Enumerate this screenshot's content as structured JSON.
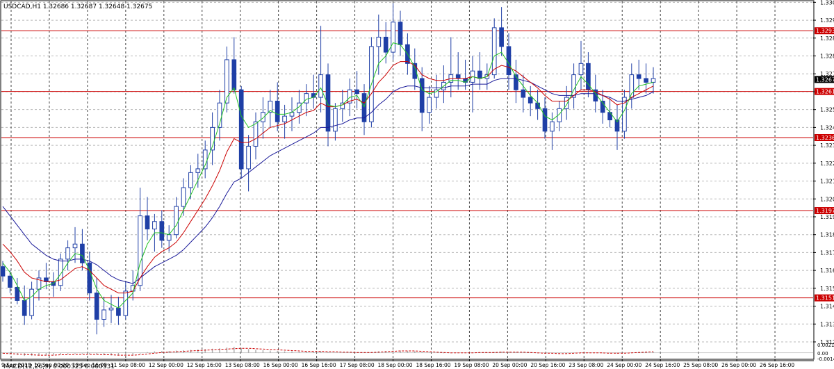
{
  "header": {
    "text": "USDCAD,H1  1.32686 1.32687 1.32648 1.32675"
  },
  "macd_header": {
    "text": "MACD(12,26,9) 0.000325 0.000331"
  },
  "colors": {
    "candle": "#1f3fa6",
    "ma_fast": "#22c222",
    "ma_mid": "#cc0000",
    "ma_slow": "#1a1a99",
    "hline": "#cc0000",
    "current_price_bg": "#000000",
    "level_bg": "#cc0000",
    "macd_hist": "#b0b0b0",
    "macd_signal": "#cc0000",
    "grid": "#b8b8b8"
  },
  "chart_data": [
    {
      "type": "candlestick",
      "symbol": "USDCAD",
      "timeframe": "H1",
      "ylim": [
        1.3128,
        1.3309
      ],
      "price_ticks": [
        "1.33085",
        "1.32990",
        "1.32895",
        "1.32800",
        "1.32705",
        "1.32610",
        "1.32515",
        "1.32420",
        "1.32325",
        "1.32230",
        "1.32135",
        "1.32040",
        "1.31945",
        "1.31850",
        "1.31755",
        "1.31660",
        "1.31565",
        "1.31470",
        "1.31375",
        "1.31280"
      ],
      "time_labels": [
        "9 Sep 2019",
        "10 Sep 00:00",
        "10 Sep 16:00",
        "11 Sep 08:00",
        "12 Sep 00:00",
        "12 Sep 16:00",
        "13 Sep 08:00",
        "16 Sep 00:00",
        "16 Sep 16:00",
        "17 Sep 08:00",
        "18 Sep 00:00",
        "18 Sep 16:00",
        "19 Sep 08:00",
        "20 Sep 00:00",
        "20 Sep 16:00",
        "23 Sep 08:00",
        "24 Sep 00:00",
        "24 Sep 16:00",
        "25 Sep 08:00",
        "26 Sep 00:00",
        "26 Sep 16:00"
      ],
      "horizontal_levels": [
        "1.32934",
        "1.32366",
        "1.31978",
        "1.31514"
      ],
      "price_level_labels": [
        {
          "label": "1.32934",
          "value": 1.32934,
          "kind": "level"
        },
        {
          "label": "1.32675",
          "value": 1.32675,
          "kind": "current"
        },
        {
          "label": "1.32611",
          "value": 1.32611,
          "kind": "level"
        },
        {
          "label": "1.32366",
          "value": 1.32366,
          "kind": "level"
        },
        {
          "label": "1.31978",
          "value": 1.31978,
          "kind": "level"
        },
        {
          "label": "1.31514",
          "value": 1.31514,
          "kind": "level"
        }
      ],
      "candles": [
        [
          1.3168,
          1.3171,
          1.316,
          1.3163
        ],
        [
          1.3163,
          1.3166,
          1.3154,
          1.3157
        ],
        [
          1.3157,
          1.3162,
          1.3148,
          1.315
        ],
        [
          1.315,
          1.3158,
          1.3137,
          1.3142
        ],
        [
          1.3142,
          1.316,
          1.314,
          1.3156
        ],
        [
          1.3156,
          1.3166,
          1.315,
          1.3162
        ],
        [
          1.3162,
          1.317,
          1.3156,
          1.316
        ],
        [
          1.316,
          1.3165,
          1.3152,
          1.3158
        ],
        [
          1.3158,
          1.3175,
          1.3155,
          1.3172
        ],
        [
          1.3172,
          1.3182,
          1.3166,
          1.3178
        ],
        [
          1.3178,
          1.3189,
          1.317,
          1.318
        ],
        [
          1.318,
          1.3188,
          1.3166,
          1.317
        ],
        [
          1.317,
          1.3176,
          1.315,
          1.3154
        ],
        [
          1.3154,
          1.3162,
          1.3132,
          1.314
        ],
        [
          1.314,
          1.3152,
          1.3136,
          1.3145
        ],
        [
          1.3145,
          1.3153,
          1.3138,
          1.3146
        ],
        [
          1.3146,
          1.3152,
          1.3137,
          1.3142
        ],
        [
          1.3142,
          1.316,
          1.314,
          1.3155
        ],
        [
          1.3155,
          1.3166,
          1.315,
          1.3158
        ],
        [
          1.3158,
          1.321,
          1.3155,
          1.3195
        ],
        [
          1.3195,
          1.3205,
          1.3182,
          1.3188
        ],
        [
          1.3188,
          1.3196,
          1.3176,
          1.3192
        ],
        [
          1.3192,
          1.3198,
          1.3178,
          1.3182
        ],
        [
          1.3182,
          1.319,
          1.3176,
          1.3185
        ],
        [
          1.3185,
          1.3205,
          1.3183,
          1.32
        ],
        [
          1.32,
          1.3215,
          1.3195,
          1.321
        ],
        [
          1.321,
          1.3222,
          1.3204,
          1.3218
        ],
        [
          1.3218,
          1.3228,
          1.321,
          1.322
        ],
        [
          1.322,
          1.3235,
          1.3215,
          1.323
        ],
        [
          1.323,
          1.325,
          1.3222,
          1.3242
        ],
        [
          1.3242,
          1.3262,
          1.3235,
          1.3255
        ],
        [
          1.3255,
          1.3285,
          1.325,
          1.3278
        ],
        [
          1.3278,
          1.329,
          1.326,
          1.3262
        ],
        [
          1.3262,
          1.3264,
          1.3215,
          1.322
        ],
        [
          1.322,
          1.3238,
          1.3208,
          1.3232
        ],
        [
          1.3232,
          1.325,
          1.3225,
          1.3245
        ],
        [
          1.3245,
          1.3258,
          1.3236,
          1.325
        ],
        [
          1.325,
          1.3262,
          1.3242,
          1.3256
        ],
        [
          1.3256,
          1.3266,
          1.324,
          1.3245
        ],
        [
          1.3245,
          1.3254,
          1.3236,
          1.3248
        ],
        [
          1.3248,
          1.3258,
          1.324,
          1.325
        ],
        [
          1.325,
          1.3262,
          1.3244,
          1.3255
        ],
        [
          1.3255,
          1.3265,
          1.3248,
          1.326
        ],
        [
          1.326,
          1.327,
          1.3252,
          1.3258
        ],
        [
          1.3258,
          1.3296,
          1.325,
          1.327
        ],
        [
          1.327,
          1.3276,
          1.3232,
          1.324
        ],
        [
          1.324,
          1.3255,
          1.3235,
          1.3252
        ],
        [
          1.3252,
          1.3262,
          1.3245,
          1.3255
        ],
        [
          1.3255,
          1.3268,
          1.3248,
          1.3262
        ],
        [
          1.3262,
          1.3272,
          1.3252,
          1.326
        ],
        [
          1.326,
          1.3265,
          1.3238,
          1.3245
        ],
        [
          1.3245,
          1.329,
          1.3242,
          1.3285
        ],
        [
          1.3285,
          1.3302,
          1.327,
          1.329
        ],
        [
          1.329,
          1.3298,
          1.3276,
          1.3282
        ],
        [
          1.3282,
          1.3308,
          1.3278,
          1.3298
        ],
        [
          1.3298,
          1.3304,
          1.328,
          1.3286
        ],
        [
          1.3286,
          1.3292,
          1.327,
          1.3276
        ],
        [
          1.3276,
          1.3284,
          1.3262,
          1.3268
        ],
        [
          1.3268,
          1.3274,
          1.324,
          1.325
        ],
        [
          1.325,
          1.3264,
          1.3244,
          1.3258
        ],
        [
          1.3258,
          1.327,
          1.3252,
          1.3262
        ],
        [
          1.3262,
          1.3275,
          1.3255,
          1.3266
        ],
        [
          1.3266,
          1.329,
          1.3258,
          1.327
        ],
        [
          1.327,
          1.3282,
          1.3262,
          1.3268
        ],
        [
          1.3268,
          1.3278,
          1.3262,
          1.3266
        ],
        [
          1.3266,
          1.328,
          1.325,
          1.3272
        ],
        [
          1.3272,
          1.3282,
          1.3262,
          1.3268
        ],
        [
          1.3268,
          1.3276,
          1.3262,
          1.327
        ],
        [
          1.327,
          1.33,
          1.3268,
          1.3295
        ],
        [
          1.3295,
          1.3306,
          1.328,
          1.3285
        ],
        [
          1.3285,
          1.3292,
          1.3262,
          1.327
        ],
        [
          1.327,
          1.3278,
          1.3255,
          1.3262
        ],
        [
          1.3262,
          1.327,
          1.325,
          1.3258
        ],
        [
          1.3258,
          1.3264,
          1.3248,
          1.3255
        ],
        [
          1.3255,
          1.3262,
          1.3246,
          1.3252
        ],
        [
          1.3252,
          1.3258,
          1.3236,
          1.324
        ],
        [
          1.324,
          1.325,
          1.323,
          1.3245
        ],
        [
          1.3245,
          1.3256,
          1.324,
          1.3252
        ],
        [
          1.3252,
          1.3264,
          1.3246,
          1.3258
        ],
        [
          1.3258,
          1.3276,
          1.3252,
          1.327
        ],
        [
          1.327,
          1.3288,
          1.3262,
          1.3276
        ],
        [
          1.3276,
          1.3282,
          1.3258,
          1.3262
        ],
        [
          1.3262,
          1.327,
          1.325,
          1.3256
        ],
        [
          1.3256,
          1.3262,
          1.3244,
          1.325
        ],
        [
          1.325,
          1.3258,
          1.3242,
          1.3246
        ],
        [
          1.3246,
          1.3254,
          1.323,
          1.324
        ],
        [
          1.324,
          1.3262,
          1.3236,
          1.3258
        ],
        [
          1.3258,
          1.3276,
          1.3252,
          1.327
        ],
        [
          1.327,
          1.3278,
          1.3262,
          1.3268
        ],
        [
          1.3268,
          1.3276,
          1.326,
          1.3266
        ],
        [
          1.3266,
          1.3274,
          1.326,
          1.3268
        ]
      ],
      "ma_fast": [
        1.317,
        1.3165,
        1.3158,
        1.315,
        1.3152,
        1.3156,
        1.3158,
        1.3159,
        1.3164,
        1.317,
        1.3175,
        1.3174,
        1.3166,
        1.3156,
        1.315,
        1.3148,
        1.3146,
        1.315,
        1.3154,
        1.317,
        1.318,
        1.3186,
        1.3186,
        1.3185,
        1.319,
        1.3198,
        1.3206,
        1.3214,
        1.3222,
        1.3232,
        1.3244,
        1.3258,
        1.3263,
        1.3248,
        1.3242,
        1.3244,
        1.3247,
        1.3251,
        1.3249,
        1.3249,
        1.325,
        1.3253,
        1.3257,
        1.3258,
        1.3263,
        1.3254,
        1.3253,
        1.3254,
        1.3258,
        1.3259,
        1.3253,
        1.3265,
        1.3276,
        1.328,
        1.3287,
        1.3286,
        1.3281,
        1.3274,
        1.3262,
        1.326,
        1.3261,
        1.3264,
        1.3267,
        1.3267,
        1.3266,
        1.3269,
        1.3268,
        1.3269,
        1.328,
        1.3282,
        1.3276,
        1.3269,
        1.3264,
        1.3259,
        1.3255,
        1.3248,
        1.3246,
        1.3249,
        1.3254,
        1.3262,
        1.3269,
        1.3265,
        1.326,
        1.3255,
        1.325,
        1.3245,
        1.3251,
        1.326,
        1.3264,
        1.3265,
        1.3266
      ],
      "ma_mid": [
        1.318,
        1.3176,
        1.3171,
        1.3165,
        1.3162,
        1.3161,
        1.316,
        1.316,
        1.3161,
        1.3164,
        1.3167,
        1.3168,
        1.3166,
        1.3162,
        1.3158,
        1.3156,
        1.3154,
        1.3154,
        1.3155,
        1.3162,
        1.3168,
        1.3173,
        1.3176,
        1.3178,
        1.3181,
        1.3186,
        1.3192,
        1.3198,
        1.3204,
        1.3211,
        1.3219,
        1.3229,
        1.3236,
        1.3234,
        1.3234,
        1.3236,
        1.3239,
        1.3242,
        1.3243,
        1.3244,
        1.3246,
        1.3248,
        1.325,
        1.3251,
        1.3255,
        1.3253,
        1.3253,
        1.3254,
        1.3256,
        1.3257,
        1.3255,
        1.326,
        1.3266,
        1.327,
        1.3275,
        1.3277,
        1.3277,
        1.3275,
        1.327,
        1.3268,
        1.3267,
        1.3267,
        1.3268,
        1.3268,
        1.3268,
        1.3269,
        1.3268,
        1.3269,
        1.3273,
        1.3275,
        1.3274,
        1.3272,
        1.3269,
        1.3266,
        1.3263,
        1.3259,
        1.3256,
        1.3256,
        1.3256,
        1.3259,
        1.3262,
        1.3262,
        1.3261,
        1.3259,
        1.3257,
        1.3254,
        1.3255,
        1.3258,
        1.326,
        1.3262,
        1.3264
      ],
      "ma_slow": [
        1.32,
        1.3195,
        1.319,
        1.3185,
        1.318,
        1.3177,
        1.3174,
        1.3172,
        1.3171,
        1.3171,
        1.3172,
        1.3172,
        1.3171,
        1.3169,
        1.3166,
        1.3163,
        1.3161,
        1.316,
        1.3159,
        1.3162,
        1.3165,
        1.3168,
        1.317,
        1.3172,
        1.3174,
        1.3177,
        1.3181,
        1.3185,
        1.3189,
        1.3194,
        1.32,
        1.3207,
        1.3213,
        1.3215,
        1.3218,
        1.3221,
        1.3224,
        1.3227,
        1.3229,
        1.3231,
        1.3233,
        1.3235,
        1.3237,
        1.3239,
        1.3242,
        1.3242,
        1.3243,
        1.3244,
        1.3246,
        1.3247,
        1.3247,
        1.325,
        1.3254,
        1.3257,
        1.3261,
        1.3263,
        1.3264,
        1.3264,
        1.3263,
        1.3263,
        1.3263,
        1.3263,
        1.3264,
        1.3264,
        1.3264,
        1.3265,
        1.3265,
        1.3265,
        1.3267,
        1.3268,
        1.3268,
        1.3268,
        1.3267,
        1.3266,
        1.3264,
        1.3262,
        1.326,
        1.3259,
        1.3259,
        1.3259,
        1.326,
        1.326,
        1.326,
        1.3259,
        1.3258,
        1.3256,
        1.3256,
        1.3257,
        1.3258,
        1.3259,
        1.3261
      ]
    },
    {
      "type": "macd",
      "title": "MACD(12,26,9) 0.000325 0.000331",
      "ylim": [
        -0.0015,
        0.00215
      ],
      "ticks": [
        "0.002156",
        "0.00",
        "-0.00149"
      ],
      "histogram": [
        -0.0002,
        -0.0004,
        -0.0006,
        -0.0008,
        -0.0008,
        -0.0007,
        -0.0006,
        -0.0005,
        -0.0004,
        -0.0003,
        -0.0002,
        -0.0002,
        -0.0003,
        -0.0005,
        -0.0006,
        -0.0007,
        -0.0007,
        -0.0006,
        -0.0005,
        -0.0002,
        0.0002,
        0.0004,
        0.0005,
        0.0005,
        0.0006,
        0.0007,
        0.0008,
        0.0009,
        0.001,
        0.0011,
        0.0012,
        0.0014,
        0.0016,
        0.0013,
        0.001,
        0.0008,
        0.0007,
        0.0006,
        0.0005,
        0.0004,
        0.0004,
        0.0003,
        0.0003,
        0.0003,
        0.0004,
        0.0002,
        0.0001,
        0.0001,
        0.0001,
        0.0001,
        0.0,
        0.0002,
        0.0004,
        0.0005,
        0.0006,
        0.0006,
        0.0005,
        0.0004,
        0.0002,
        0.0001,
        0.0,
        -0.0001,
        -0.0001,
        0.0,
        0.0,
        0.0001,
        0.0001,
        0.0001,
        0.0002,
        0.0003,
        0.0003,
        0.0002,
        0.0001,
        0.0,
        -0.0001,
        -0.0002,
        -0.0002,
        -0.0002,
        -0.0001,
        0.0,
        0.0001,
        0.0001,
        0.0,
        -0.0001,
        -0.0001,
        -0.0002,
        -0.0001,
        0.0001,
        0.0002,
        0.0003,
        0.0003
      ],
      "signal": [
        -0.0001,
        -0.0002,
        -0.0003,
        -0.0004,
        -0.0005,
        -0.0006,
        -0.0006,
        -0.0006,
        -0.0005,
        -0.0005,
        -0.0004,
        -0.0004,
        -0.0004,
        -0.0004,
        -0.0005,
        -0.0005,
        -0.0006,
        -0.0006,
        -0.0006,
        -0.0005,
        -0.0003,
        -0.0001,
        0.0001,
        0.0002,
        0.0003,
        0.0004,
        0.0005,
        0.0006,
        0.0007,
        0.0008,
        0.0009,
        0.001,
        0.0011,
        0.0012,
        0.0012,
        0.0011,
        0.001,
        0.0009,
        0.0008,
        0.0007,
        0.0006,
        0.0005,
        0.0004,
        0.0004,
        0.0004,
        0.0003,
        0.0003,
        0.0002,
        0.0002,
        0.0001,
        0.0001,
        0.0001,
        0.0002,
        0.0003,
        0.0004,
        0.0005,
        0.0005,
        0.0005,
        0.0004,
        0.0003,
        0.0002,
        0.0001,
        0.0,
        0.0,
        0.0,
        0.0,
        0.0001,
        0.0001,
        0.0001,
        0.0002,
        0.0002,
        0.0002,
        0.0002,
        0.0001,
        0.0,
        -0.0001,
        -0.0001,
        -0.0002,
        -0.0002,
        -0.0001,
        0.0,
        0.0,
        0.0,
        0.0,
        -0.0001,
        -0.0001,
        -0.0001,
        0.0,
        0.0001,
        0.0002,
        0.0003
      ]
    }
  ]
}
